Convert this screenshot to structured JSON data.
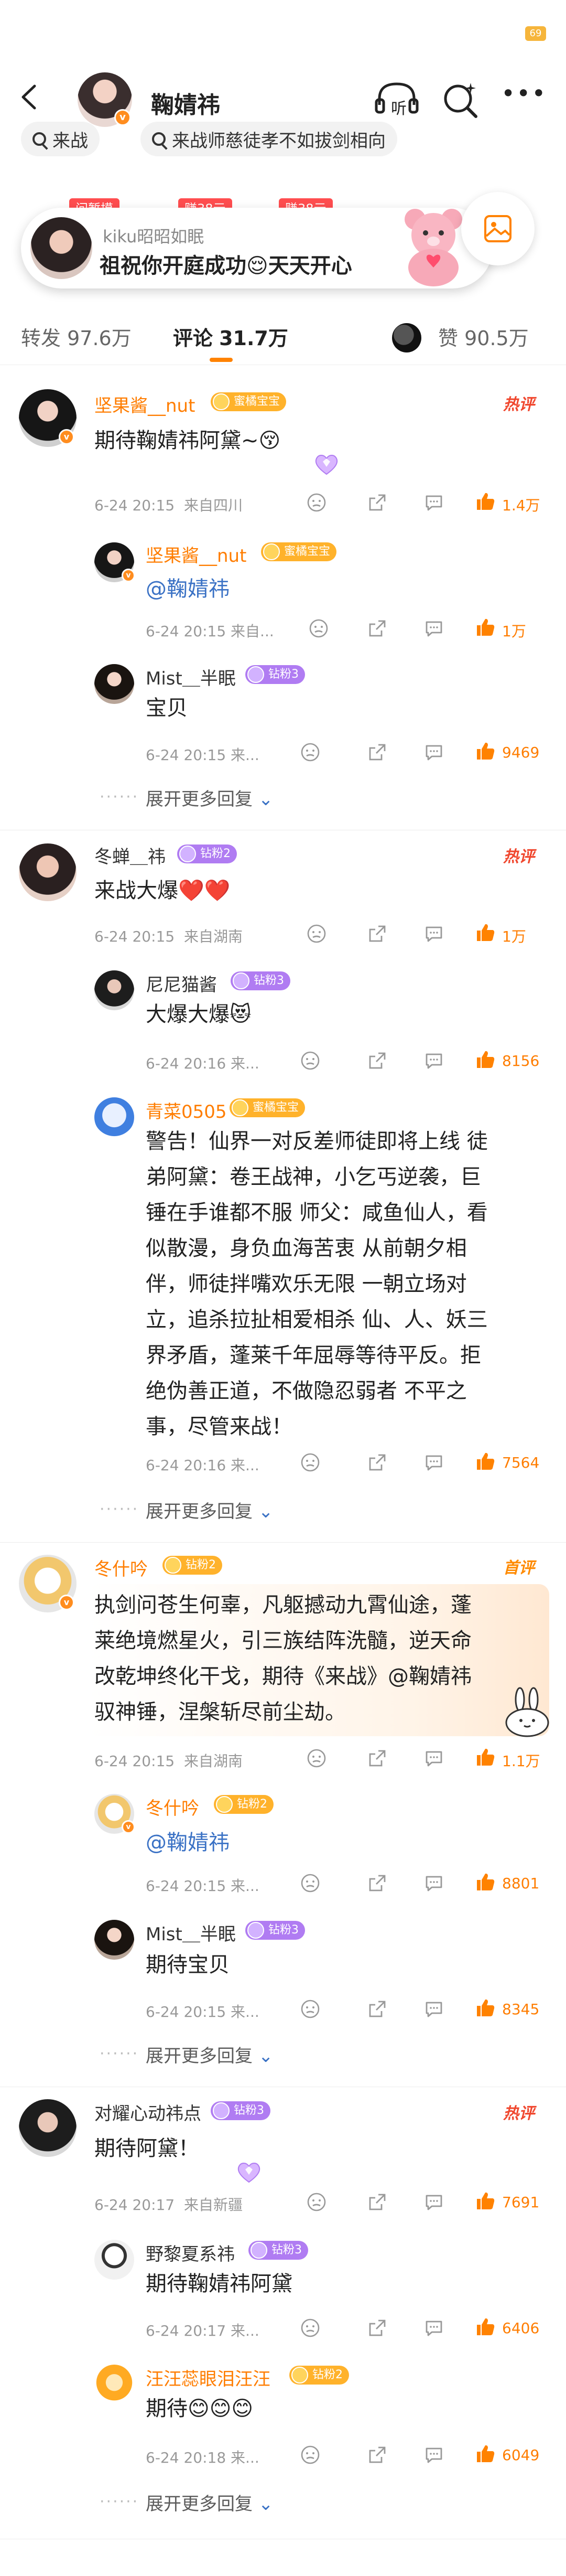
{
  "status": {
    "battery": "69"
  },
  "header": {
    "name": "鞠婧祎",
    "listen_label": "听"
  },
  "search_chips": [
    "来战",
    "来战师慈徒孝不如拔剑相向"
  ],
  "banner": {
    "tags": [
      "问暂摸",
      "赚38元",
      "赚38元"
    ],
    "user": "kiku昭昭如眠",
    "text": "祖祝你开庭成功😌天天开心"
  },
  "tabs": {
    "repost_label": "转发",
    "repost_count": "97.6万",
    "comment_label": "评论",
    "comment_count": "31.7万",
    "like_label": "赞",
    "like_count": "90.5万"
  },
  "labels": {
    "hot": "热评",
    "top": "首评",
    "expand": "展开更多回复",
    "dots": "······",
    "chevron": "⌄"
  },
  "comments": [
    {
      "user": "坚果酱__nut",
      "badge": "蜜橘宝宝",
      "text": "期待鞠婧祎阿黛~😚",
      "time": "6-24 20:15",
      "loc": "来自四川",
      "likes": "1.4万",
      "replies": [
        {
          "user": "坚果酱__nut",
          "badge": "蜜橘宝宝",
          "text": "@鞠婧祎",
          "time": "6-24 20:15 来自...",
          "likes": "1万"
        },
        {
          "user": "Mist＿半眠",
          "badge": "钻粉3",
          "text": "宝贝",
          "time": "6-24 20:15 来...",
          "likes": "9469"
        }
      ]
    },
    {
      "user": "冬蝉＿祎",
      "badge": "钻粉2",
      "text": "来战大爆❤️❤️",
      "time": "6-24 20:15",
      "loc": "来自湖南",
      "likes": "1万",
      "replies": [
        {
          "user": "尼尼猫酱",
          "badge": "钻粉3",
          "text": "大爆大爆😻",
          "time": "6-24 20:16 来...",
          "likes": "8156"
        },
        {
          "user": "青菜0505",
          "badge": "蜜橘宝宝",
          "lines": [
            "警告！仙界一对反差师徒即将上线 徒",
            "弟阿黛：卷王战神，小乞丐逆袭，巨",
            "锤在手谁都不服 师父：咸鱼仙人，看",
            "似散漫，身负血海苦衷 从前朝夕相",
            "伴，师徒拌嘴欢乐无限 一朝立场对",
            "立，追杀拉扯相爱相杀 仙、人、妖三",
            "界矛盾，蓬莱千年屈辱等待平反。拒",
            "绝伪善正道，不做隐忍弱者 不平之",
            "事，尽管来战！"
          ],
          "time": "6-24 20:16 来...",
          "likes": "7564"
        }
      ]
    },
    {
      "user": "冬什吟",
      "badge": "钻粉2",
      "lines": [
        "执剑问苍生何辜，凡躯撼动九霄仙途，蓬",
        "莱绝境燃星火，引三族结阵洗髓，逆天命",
        "改乾坤终化干戈，期待《来战》@鞠婧祎",
        "驭神锤，涅槃斩尽前尘劫。"
      ],
      "time": "6-24 20:15",
      "loc": "来自湖南",
      "likes": "1.1万",
      "replies": [
        {
          "user": "冬什吟",
          "badge": "钻粉2",
          "text": "@鞠婧祎",
          "time": "6-24 20:15 来...",
          "likes": "8801"
        },
        {
          "user": "Mist＿半眠",
          "badge": "钻粉3",
          "text": "期待宝贝",
          "time": "6-24 20:15 来...",
          "likes": "8345"
        }
      ]
    },
    {
      "user": "对耀心动祎点",
      "badge": "钻粉3",
      "text": "期待阿黛！",
      "time": "6-24 20:17",
      "loc": "来自新疆",
      "likes": "7691",
      "replies": [
        {
          "user": "野黎夏系祎",
          "badge": "钻粉3",
          "text": "期待鞠婧祎阿黛",
          "time": "6-24 20:17 来...",
          "likes": "6406"
        },
        {
          "user": "汪汪蕊眼泪汪汪",
          "badge": "钻粉2",
          "text": "期待😊😊😊",
          "time": "6-24 20:18 来...",
          "likes": "6049"
        }
      ]
    }
  ]
}
